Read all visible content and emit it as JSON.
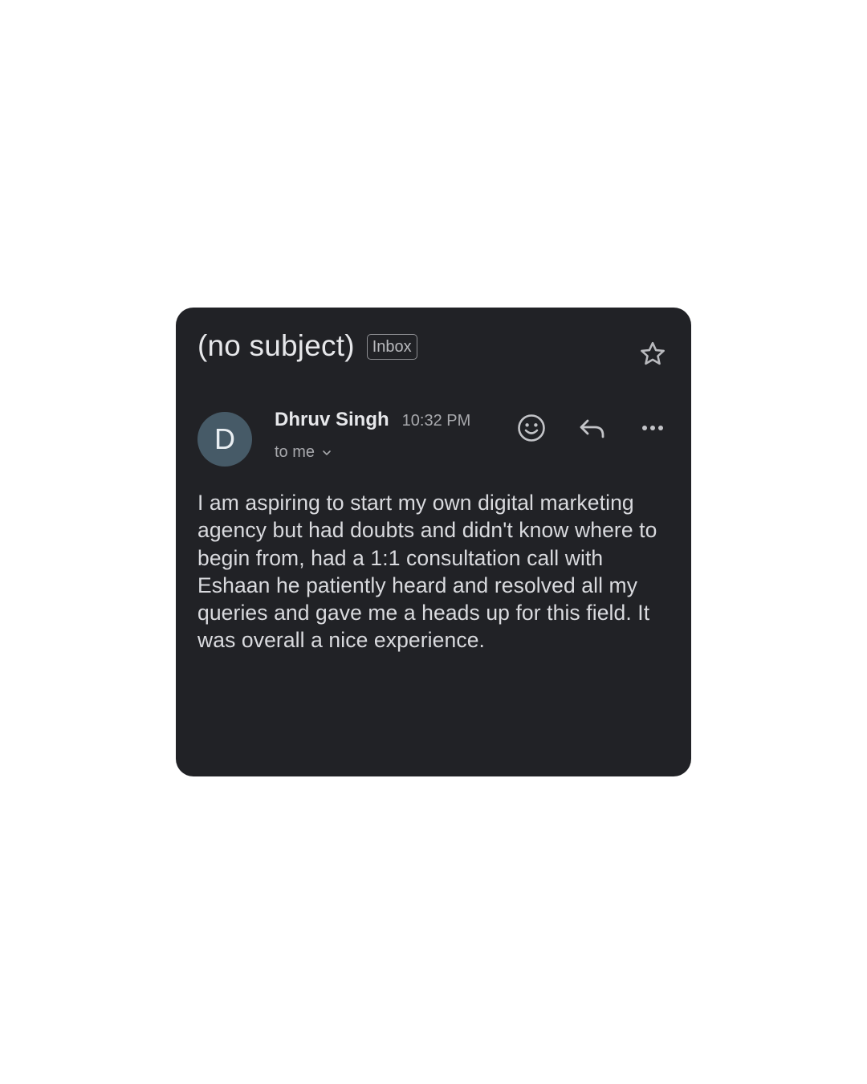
{
  "email": {
    "subject": "(no subject)",
    "label": "Inbox",
    "sender_initial": "D",
    "sender_name": "Dhruv Singh",
    "time": "10:32 PM",
    "recipient": "to me",
    "body": "I am aspiring to start my own digital marketing agency but had doubts and didn't know where to begin from, had a 1:1 consultation call with Eshaan he patiently heard and resolved all my queries and gave me a heads up for this field. It was overall a nice experience."
  },
  "icons": {
    "star": "star-icon",
    "emoji": "emoji-reaction-icon",
    "reply": "reply-icon",
    "more": "more-options-icon",
    "recipient_toggle": "chevron-down-icon"
  },
  "colors": {
    "card_background": "#212226",
    "avatar_background": "#465a67",
    "primary_text": "#e6e7ea",
    "secondary_text": "#a8a9ad"
  }
}
